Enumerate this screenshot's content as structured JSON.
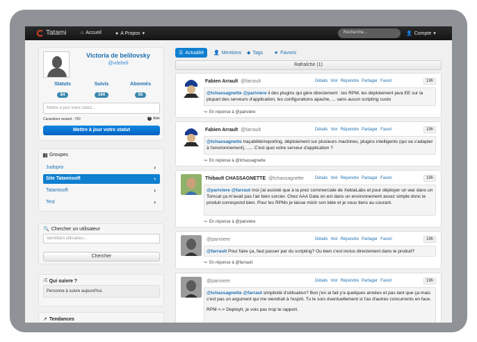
{
  "nav": {
    "brand": "Tatami",
    "home": "Accueil",
    "about": "A Propos",
    "search_placeholder": "Recherche...",
    "account": "Compte"
  },
  "profile": {
    "name": "Victoria de belilovsky",
    "username": "@vdebeli",
    "stats": [
      {
        "label": "Statuts",
        "value": "84"
      },
      {
        "label": "Suivis",
        "value": "104"
      },
      {
        "label": "Abonnés",
        "value": "55"
      }
    ],
    "status_placeholder": "Mettre à jour votre statut...",
    "chars_left": "Caractères restant : 750",
    "help": "Aide",
    "submit": "Mettre à jour votre statut"
  },
  "groups": {
    "title": "Groupes",
    "items": [
      {
        "label": "Judopro"
      },
      {
        "label": "Site Tatamisoft"
      },
      {
        "label": "Tatamisoft"
      },
      {
        "label": "Test"
      }
    ]
  },
  "finder": {
    "title": "Chercher un utilisateur",
    "placeholder": "Identifiant utilisateur...",
    "button": "Chercher"
  },
  "suggest": {
    "title": "Qui suivre ?",
    "empty": "Personne à suivre aujourd'hui."
  },
  "trends": {
    "title": "Tendances"
  },
  "tabs": [
    {
      "label": "Actualité"
    },
    {
      "label": "Mentions"
    },
    {
      "label": "Tags"
    },
    {
      "label": "Favoris"
    }
  ],
  "refresh": "Rafraîchir (1)",
  "actions": {
    "details": "Détails",
    "view": "Voir",
    "reply": "Répondre",
    "share": "Partager",
    "favorite": "Favori"
  },
  "posts": [
    {
      "author": "Fabien Arrault",
      "handle": "@farrault",
      "time": "19h",
      "mentions": "@tchassagnette @pariviere",
      "text": " il des plugins qui gère directement : les RPM, les déploiement java EE sur la plupart des serveurs d'application, les configurations apache, ... sans aucun scripting custo",
      "reply": "En réponse à @pariviere"
    },
    {
      "author": "Fabien Arrault",
      "handle": "@farrault",
      "time": "19h",
      "mentions": "@tchassagnette",
      "text": " traçabilité/reporting, déploiement sur plusieurs machines, plugins intelligents (qui va s'adapter à l'environnement), ..... C'est quoi votre serveur d'application ?",
      "reply": "En réponse à @tchassagnette"
    },
    {
      "author": "Thibault CHASSAGNETTE",
      "handle": "@tchassagnette",
      "time": "19h",
      "mentions": "@pariviere @farraut",
      "text": " moi j'ai assisté que à la prez commerciale de XebiaLabs et pour déployer un war dans un Tomcat ça m'avait pas l'air bien sorcier. Chez AAA Data on est dans un environnement assez simple donc le produit correspond bien. Pour les RPMs je laisse mûrir son idée et je vous tiens au courant.",
      "reply": "En réponse à @pariviere"
    },
    {
      "author": "",
      "handle": "@pariviere",
      "time": "19h",
      "mentions": "@farrault",
      "text": " Pour faire ça, faut passer par du scripting? Ou bien c'est inclus directement dans le produit?",
      "reply": "En réponse à @farrault"
    },
    {
      "author": "",
      "handle": "@pariviere",
      "time": "19h",
      "mentions": "@tchassagnette @farraut",
      "text": " simplicité d'utilisation? Bon j'en ai fait y'a quelques années et pas tant que ça mais c'est pas un argument qui me viendrait à l'esprit. Tu le sors éventuellement si t'as d'autres concurrents en face.",
      "text2": "RPM <-> DeployIt, je vois pas trop le rapport.",
      "reply": ""
    }
  ],
  "colors": {
    "accent": "#0f7fd0",
    "link": "#1e6fb0",
    "navbar": "#1b1b1b",
    "frame": "#8f9296"
  }
}
